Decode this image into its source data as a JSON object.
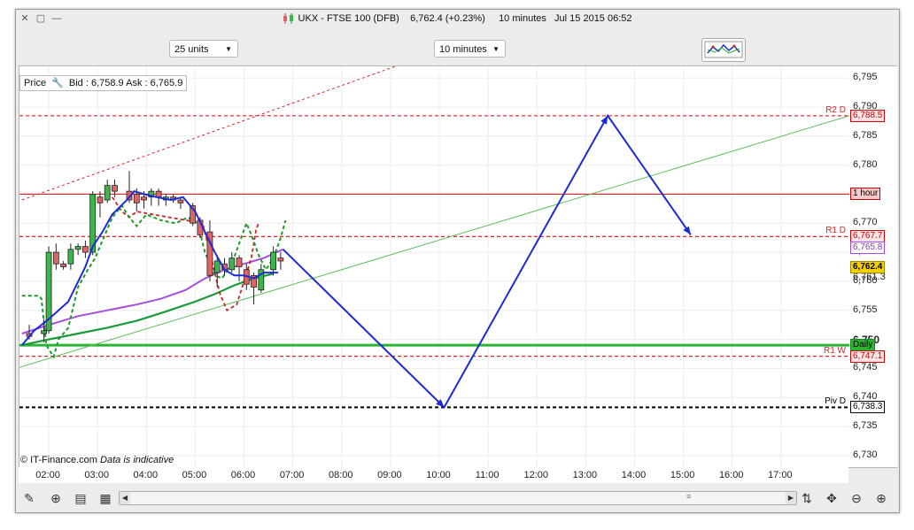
{
  "window": {
    "title": "UKX - FTSE 100 (DFB)",
    "quote": "6,762.4 (+0.23%)",
    "interval": "10 minutes",
    "datetime": "Jul 15 2015 06:52"
  },
  "controls": {
    "units": "25 units",
    "timeframe": "10 minutes"
  },
  "price_header": {
    "label": "Price",
    "bid_ask": "Bid : 6,758.9 Ask : 6,765.9"
  },
  "footer": {
    "copyright": "© IT-Finance.com",
    "note": "Data is indicative"
  },
  "colors": {
    "up_candle": "#3cb54a",
    "down_candle": "#e06464",
    "blue_line": "#1c2bd8",
    "purple_ma": "#a64de0",
    "green_ma": "#1a9a3a",
    "resistance": "#dd2222",
    "support_line": "#2bb334"
  },
  "chart_data": {
    "type": "line",
    "instrument": "UKX - FTSE 100 (DFB)",
    "y_ticks": [
      "6,795",
      "6,790",
      "6,785",
      "6,780",
      "6,775",
      "6,770",
      "6,765",
      "6,760",
      "6,755",
      "6,750",
      "6,745",
      "6,740",
      "6,735",
      "6,730"
    ],
    "ylim": [
      6728,
      6797
    ],
    "x_ticks": [
      "02:00",
      "03:00",
      "04:00",
      "05:00",
      "06:00",
      "07:00",
      "08:00",
      "09:00",
      "10:00",
      "11:00",
      "12:00",
      "13:00",
      "14:00",
      "15:00",
      "16:00",
      "17:00"
    ],
    "xlim_hours": [
      1.4,
      18.4
    ],
    "levels": [
      {
        "name": "R2 D",
        "value": 6788.5,
        "label": "6,788.5",
        "color": "#dd2222",
        "style": "dashed"
      },
      {
        "name": "1 hour",
        "value": 6775.0,
        "label": "1 hour",
        "color": "#dd2222",
        "style": "solid"
      },
      {
        "name": "R1 D",
        "value": 6767.7,
        "label": "6,767.7",
        "color": "#dd2222",
        "style": "dashed"
      },
      {
        "name": "MA",
        "value": 6765.8,
        "label": "6,765.8",
        "color": "#a64de0",
        "style": "none"
      },
      {
        "name": "Last",
        "value": 6762.4,
        "label": "6,762.4",
        "color": "#e8c000",
        "style": "none"
      },
      {
        "name": "Daily",
        "value": 6749.0,
        "label": "Daily",
        "color": "#2bb334",
        "style": "solid"
      },
      {
        "name": "R1 W",
        "value": 6747.1,
        "label": "6,747.1",
        "color": "#dd2222",
        "style": "dashed"
      },
      {
        "name": "Piv D",
        "value": 6738.3,
        "label": "6,738.3",
        "color": "#000000",
        "style": "dashed"
      }
    ],
    "bold_tick": "6,750",
    "hidden_tick": "6,761.3",
    "candles": [
      {
        "t": 1.6,
        "o": 6751.0,
        "h": 6752.5,
        "l": 6750.0,
        "c": 6750.5
      },
      {
        "t": 1.9,
        "o": 6751.0,
        "h": 6753.5,
        "l": 6749.5,
        "c": 6751.5
      },
      {
        "t": 2.0,
        "o": 6751.5,
        "h": 6766.0,
        "l": 6751.0,
        "c": 6765.0
      },
      {
        "t": 2.15,
        "o": 6765.0,
        "h": 6766.5,
        "l": 6762.0,
        "c": 6763.0
      },
      {
        "t": 2.3,
        "o": 6763.0,
        "h": 6763.5,
        "l": 6762.0,
        "c": 6762.5
      },
      {
        "t": 2.45,
        "o": 6763.0,
        "h": 6766.5,
        "l": 6762.0,
        "c": 6765.5
      },
      {
        "t": 2.6,
        "o": 6765.5,
        "h": 6766.5,
        "l": 6764.5,
        "c": 6766.0
      },
      {
        "t": 2.75,
        "o": 6766.0,
        "h": 6767.0,
        "l": 6764.0,
        "c": 6765.0
      },
      {
        "t": 2.9,
        "o": 6765.0,
        "h": 6775.5,
        "l": 6764.5,
        "c": 6775.0
      },
      {
        "t": 3.05,
        "o": 6774.5,
        "h": 6775.5,
        "l": 6771.0,
        "c": 6773.5
      },
      {
        "t": 3.2,
        "o": 6774.0,
        "h": 6777.5,
        "l": 6773.5,
        "c": 6776.5
      },
      {
        "t": 3.35,
        "o": 6776.5,
        "h": 6777.5,
        "l": 6774.5,
        "c": 6775.5
      },
      {
        "t": 3.65,
        "o": 6775.5,
        "h": 6779.0,
        "l": 6773.5,
        "c": 6774.0
      },
      {
        "t": 3.8,
        "o": 6775.0,
        "h": 6776.0,
        "l": 6772.0,
        "c": 6773.5
      },
      {
        "t": 3.95,
        "o": 6774.5,
        "h": 6775.5,
        "l": 6772.5,
        "c": 6774.0
      },
      {
        "t": 4.1,
        "o": 6774.5,
        "h": 6776.0,
        "l": 6773.0,
        "c": 6775.5
      },
      {
        "t": 4.25,
        "o": 6775.5,
        "h": 6776.0,
        "l": 6773.0,
        "c": 6774.5
      },
      {
        "t": 4.4,
        "o": 6774.0,
        "h": 6775.0,
        "l": 6773.0,
        "c": 6774.5
      },
      {
        "t": 4.55,
        "o": 6774.5,
        "h": 6775.0,
        "l": 6773.5,
        "c": 6774.0
      },
      {
        "t": 4.7,
        "o": 6774.0,
        "h": 6774.5,
        "l": 6772.5,
        "c": 6773.5
      },
      {
        "t": 4.95,
        "o": 6773.0,
        "h": 6773.5,
        "l": 6769.5,
        "c": 6770.0
      },
      {
        "t": 5.1,
        "o": 6770.5,
        "h": 6771.0,
        "l": 6767.5,
        "c": 6768.0
      },
      {
        "t": 5.3,
        "o": 6768.5,
        "h": 6770.5,
        "l": 6760.0,
        "c": 6761.0
      },
      {
        "t": 5.45,
        "o": 6761.5,
        "h": 6764.5,
        "l": 6759.0,
        "c": 6763.5
      },
      {
        "t": 5.6,
        "o": 6763.0,
        "h": 6764.0,
        "l": 6761.0,
        "c": 6762.0
      },
      {
        "t": 5.75,
        "o": 6762.0,
        "h": 6765.0,
        "l": 6761.5,
        "c": 6764.0
      },
      {
        "t": 5.9,
        "o": 6764.0,
        "h": 6764.5,
        "l": 6760.0,
        "c": 6762.5
      },
      {
        "t": 6.05,
        "o": 6762.0,
        "h": 6763.0,
        "l": 6758.5,
        "c": 6759.5
      },
      {
        "t": 6.2,
        "o": 6761.0,
        "h": 6761.5,
        "l": 6756.0,
        "c": 6759.0
      },
      {
        "t": 6.35,
        "o": 6758.5,
        "h": 6763.0,
        "l": 6758.0,
        "c": 6762.0
      },
      {
        "t": 6.6,
        "o": 6762.0,
        "h": 6766.0,
        "l": 6761.0,
        "c": 6765.0
      },
      {
        "t": 6.75,
        "o": 6764.0,
        "h": 6765.0,
        "l": 6762.0,
        "c": 6763.5
      }
    ],
    "series": [
      {
        "kind": "blue_line",
        "points": [
          [
            1.45,
            6749.0
          ],
          [
            1.7,
            6751.5
          ],
          [
            2.0,
            6753.5
          ],
          [
            2.4,
            6756.5
          ],
          [
            2.75,
            6762.5
          ],
          [
            2.9,
            6766.0
          ],
          [
            3.1,
            6768.5
          ],
          [
            3.3,
            6771.5
          ],
          [
            3.6,
            6774.0
          ],
          [
            3.75,
            6775.5
          ],
          [
            3.95,
            6775.0
          ],
          [
            4.2,
            6774.5
          ],
          [
            4.5,
            6774.0
          ],
          [
            4.75,
            6774.5
          ],
          [
            5.0,
            6772.0
          ],
          [
            5.2,
            6768.5
          ],
          [
            5.4,
            6765.0
          ],
          [
            5.6,
            6762.0
          ],
          [
            5.8,
            6761.0
          ],
          [
            6.0,
            6761.0
          ],
          [
            6.2,
            6760.5
          ],
          [
            6.4,
            6761.5
          ],
          [
            6.7,
            6761.5
          ]
        ]
      },
      {
        "kind": "green_dashed",
        "points": [
          [
            1.45,
            6757.5
          ],
          [
            1.8,
            6757.5
          ],
          [
            1.85,
            6757.0
          ],
          [
            1.95,
            6749.0
          ],
          [
            2.1,
            6747.0
          ],
          [
            2.2,
            6750.0
          ],
          [
            2.4,
            6752.0
          ],
          [
            2.6,
            6759.0
          ],
          [
            2.8,
            6762.0
          ],
          [
            2.95,
            6764.0
          ],
          [
            3.15,
            6768.0
          ],
          [
            3.3,
            6771.0
          ],
          [
            3.5,
            6773.0
          ],
          [
            3.65,
            6771.0
          ],
          [
            3.8,
            6769.5
          ],
          [
            4.0,
            6771.5
          ],
          [
            4.3,
            6770.5
          ],
          [
            4.6,
            6770.0
          ],
          [
            4.85,
            6771.0
          ],
          [
            5.05,
            6770.0
          ],
          [
            5.2,
            6765.0
          ],
          [
            5.4,
            6761.0
          ],
          [
            5.55,
            6760.5
          ],
          [
            5.75,
            6763.0
          ],
          [
            5.9,
            6766.5
          ],
          [
            6.05,
            6770.0
          ],
          [
            6.15,
            6768.0
          ],
          [
            6.3,
            6764.5
          ],
          [
            6.45,
            6762.0
          ],
          [
            6.6,
            6764.0
          ],
          [
            6.75,
            6767.5
          ],
          [
            6.85,
            6770.5
          ]
        ]
      },
      {
        "kind": "red_dashed",
        "points": [
          [
            3.3,
            6774.5
          ],
          [
            3.5,
            6772.0
          ],
          [
            3.65,
            6771.0
          ],
          [
            3.8,
            6772.0
          ],
          [
            5.15,
            6770.0
          ],
          [
            5.3,
            6765.0
          ],
          [
            5.5,
            6758.0
          ],
          [
            5.65,
            6755.0
          ],
          [
            5.85,
            6756.0
          ],
          [
            6.0,
            6760.0
          ],
          [
            6.15,
            6764.0
          ],
          [
            6.25,
            6769.0
          ],
          [
            6.3,
            6770.0
          ]
        ]
      },
      {
        "kind": "purple_ma",
        "points": [
          [
            1.45,
            6751.0
          ],
          [
            2.0,
            6752.5
          ],
          [
            2.6,
            6754.0
          ],
          [
            3.2,
            6755.0
          ],
          [
            3.8,
            6756.0
          ],
          [
            4.3,
            6757.0
          ],
          [
            4.8,
            6758.5
          ],
          [
            5.2,
            6760.5
          ],
          [
            5.6,
            6762.0
          ],
          [
            6.0,
            6763.0
          ],
          [
            6.4,
            6764.0
          ],
          [
            6.8,
            6765.5
          ]
        ]
      },
      {
        "kind": "green_ma",
        "points": [
          [
            1.45,
            6749.0
          ],
          [
            2.0,
            6750.0
          ],
          [
            2.6,
            6751.0
          ],
          [
            3.2,
            6752.0
          ],
          [
            3.8,
            6753.2
          ],
          [
            4.4,
            6754.8
          ],
          [
            5.0,
            6756.5
          ],
          [
            5.4,
            6757.8
          ],
          [
            5.8,
            6759.3
          ],
          [
            6.2,
            6760.5
          ],
          [
            6.6,
            6761.3
          ]
        ]
      },
      {
        "kind": "forecast",
        "points": [
          [
            6.8,
            6765.5
          ],
          [
            10.1,
            6738.3
          ],
          [
            13.45,
            6788.5
          ],
          [
            15.15,
            6768.0
          ]
        ]
      },
      {
        "kind": "trend_green",
        "points": [
          [
            1.4,
            6745.2
          ],
          [
            18.4,
            6788.5
          ]
        ]
      },
      {
        "kind": "trend_red",
        "points": [
          [
            1.45,
            6774.0
          ],
          [
            9.1,
            6797.0
          ]
        ]
      }
    ]
  }
}
